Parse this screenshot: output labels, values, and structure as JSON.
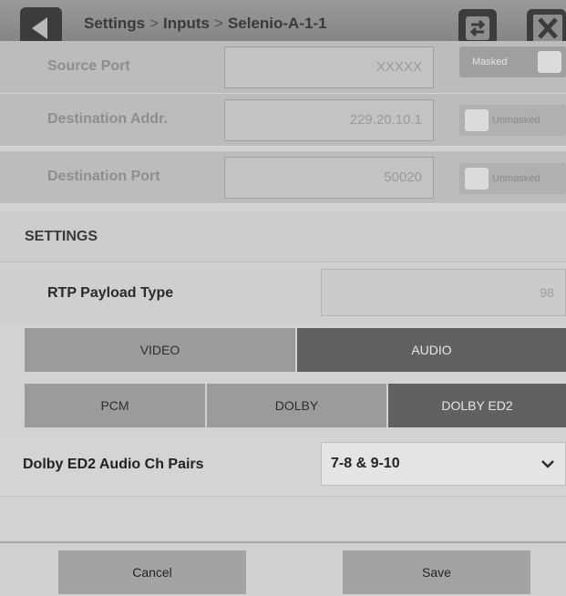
{
  "header": {
    "breadcrumb": [
      "Settings",
      "Inputs",
      "Selenio-A-1-1"
    ],
    "separator": ">"
  },
  "rows": [
    {
      "label": "Source Port",
      "value": "XXXXX",
      "toggle": "Masked",
      "state": "masked"
    },
    {
      "label": "Destination Addr.",
      "value": "229.20.10.1",
      "toggle": "Unmasked",
      "state": "unmasked"
    },
    {
      "label": "Destination Port",
      "value": "50020",
      "toggle": "Unmasked",
      "state": "unmasked"
    }
  ],
  "settings": {
    "header": "SETTINGS",
    "rtp_label": "RTP Payload Type",
    "rtp_value": "98"
  },
  "media_tabs": [
    {
      "label": "VIDEO",
      "selected": false
    },
    {
      "label": "AUDIO",
      "selected": true
    }
  ],
  "audio_tabs": [
    {
      "label": "PCM",
      "selected": false
    },
    {
      "label": "DOLBY",
      "selected": false
    },
    {
      "label": "DOLBY ED2",
      "selected": true
    }
  ],
  "ed2": {
    "label": "Dolby ED2 Audio Ch Pairs",
    "value": "7-8 & 9-10"
  },
  "footer": {
    "cancel": "Cancel",
    "save": "Save"
  },
  "icons": {
    "back": "back-arrow-icon",
    "swap": "swap-icon",
    "close": "close-icon",
    "dropdown": "chevron-down-icon"
  }
}
